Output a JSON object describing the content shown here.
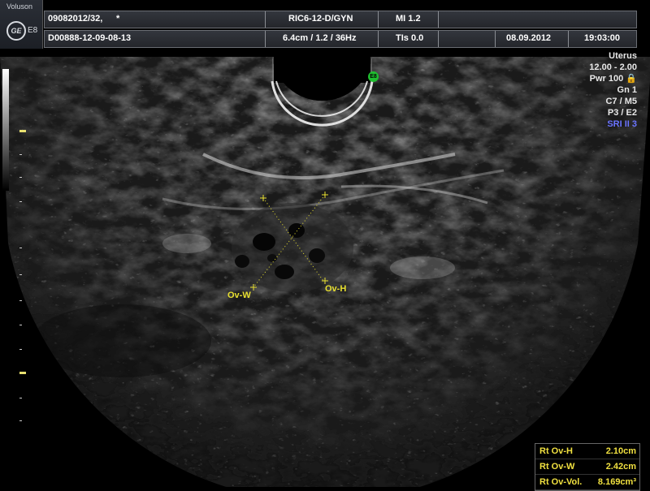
{
  "header": {
    "brand": "Voluson",
    "logo": "GE",
    "model": "E8",
    "patient_id": "09082012/32,",
    "patient_mark": "*",
    "probe": "RIC6-12-D/GYN",
    "mi": "MI  1.2",
    "exam_id": "D00888-12-09-08-13",
    "depth": "6.4cm / 1.2 / 36Hz",
    "tis": "TIs  0.0",
    "date": "08.09.2012",
    "time": "19:03:00"
  },
  "params": {
    "preset": "Uterus",
    "freq": "12.00 - 2.00",
    "power": "Pwr 100 🔒",
    "gain": "Gn  1",
    "c_m": "C7 / M5",
    "p_e": "P3 / E2",
    "sri": "SRI II 3"
  },
  "probe_marker": "E8",
  "calipers": {
    "ov_w": "Ov-W",
    "ov_h": "Ov-H"
  },
  "measurements": [
    {
      "name": "Rt Ov-H",
      "value": "2.10cm"
    },
    {
      "name": "Rt Ov-W",
      "value": "2.42cm"
    },
    {
      "name": "Rt Ov-Vol.",
      "value": "8.169cm³"
    }
  ],
  "colors": {
    "caliper": "#e8e030",
    "sri": "#6b74ff",
    "marker": "#1fbf2f"
  }
}
